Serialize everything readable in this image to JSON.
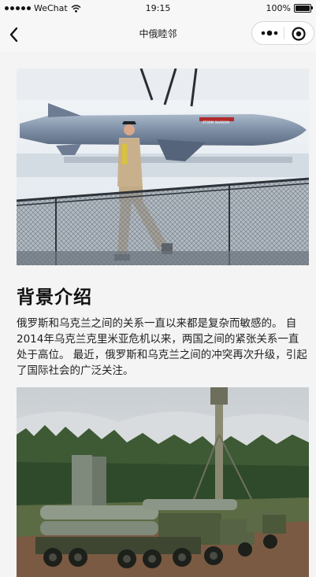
{
  "status_bar": {
    "carrier": "WeChat",
    "time": "19:15",
    "battery": "100%"
  },
  "nav": {
    "title": "中俄睦邻",
    "back_icon": "chevron-left-icon",
    "more_icon": "more-dots-icon",
    "close_icon": "target-close-icon"
  },
  "article": {
    "section_title": "背景介绍",
    "section_body": "俄罗斯和乌克兰之间的关系一直以来都是复杂而敏感的。 自2014年乌克兰克里米亚危机以来，两国之间的紧张关系一直处于高位。 最近，俄罗斯和乌克兰之间的冲突再次升级，引起了国际社会的广泛关注。",
    "images": [
      {
        "subject": "cruise-missile-display-photo",
        "missile_label": "STORM SHADOW"
      },
      {
        "subject": "missile-launcher-trucks-photo"
      }
    ]
  }
}
